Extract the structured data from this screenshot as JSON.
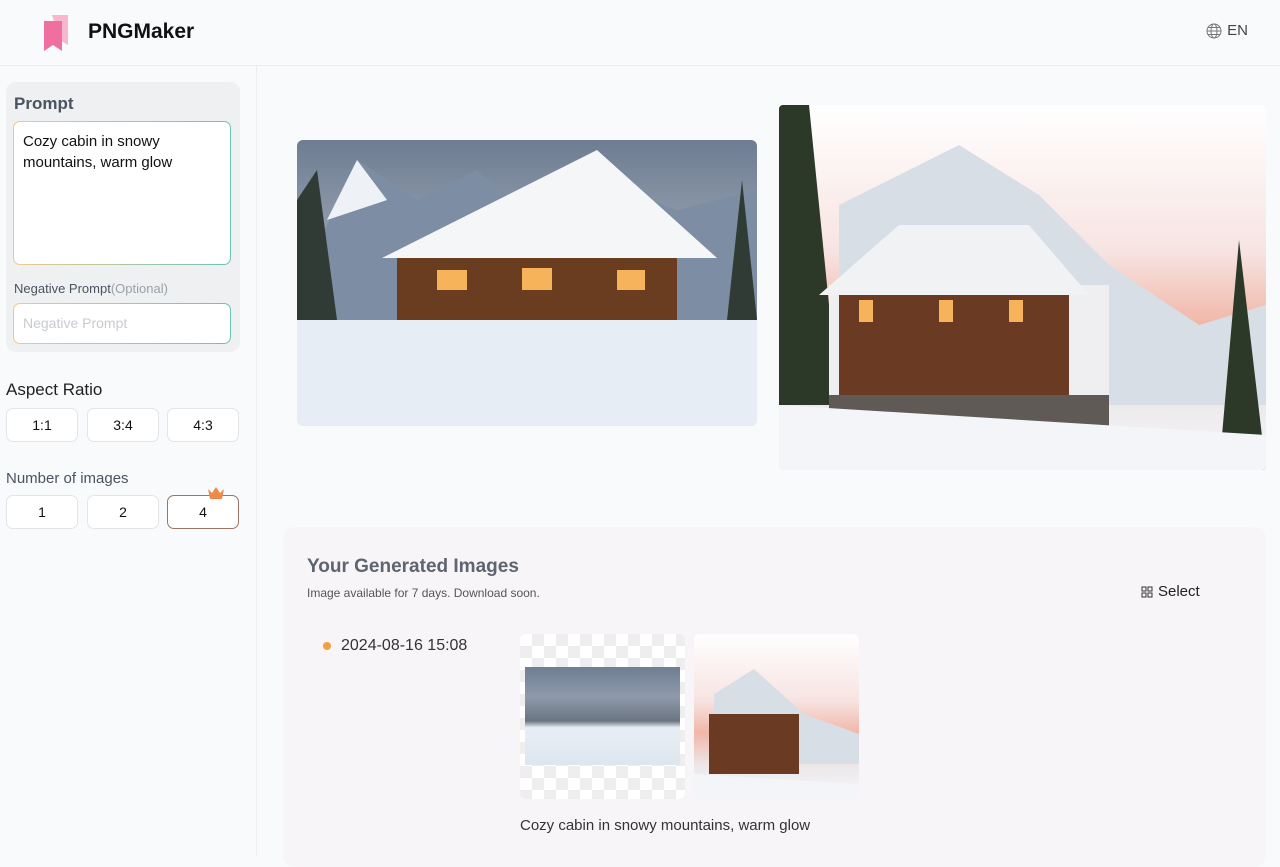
{
  "header": {
    "brand": "PNGMaker",
    "lang": "EN",
    "lang_icon": "globe-icon"
  },
  "sidebar": {
    "prompt_title": "Prompt",
    "prompt_value": "Cozy cabin in snowy mountains, warm glow",
    "negative_label": "Negative Prompt",
    "negative_optional": "(Optional)",
    "negative_placeholder": "Negative Prompt",
    "aspect_title": "Aspect Ratio",
    "aspect_options": [
      "1:1",
      "3:4",
      "4:3"
    ],
    "aspect_selected": "4:3",
    "count_title": "Number of images",
    "count_options": [
      "1",
      "2",
      "4"
    ],
    "count_selected": "2",
    "premium_icon": "crown-icon"
  },
  "gallery": {
    "title": "Your Generated Images",
    "subtitle": "Image available for 7 days. Download soon.",
    "select_label": "Select",
    "entries": [
      {
        "date": "2024-08-16 15:08",
        "caption": "Cozy cabin in snowy mountains, warm glow"
      }
    ]
  },
  "colors": {
    "accent_start": "#f0c98a",
    "accent_end": "#6cc4b6",
    "brand_pink": "#ef6fa0",
    "dot": "#f0a040"
  }
}
